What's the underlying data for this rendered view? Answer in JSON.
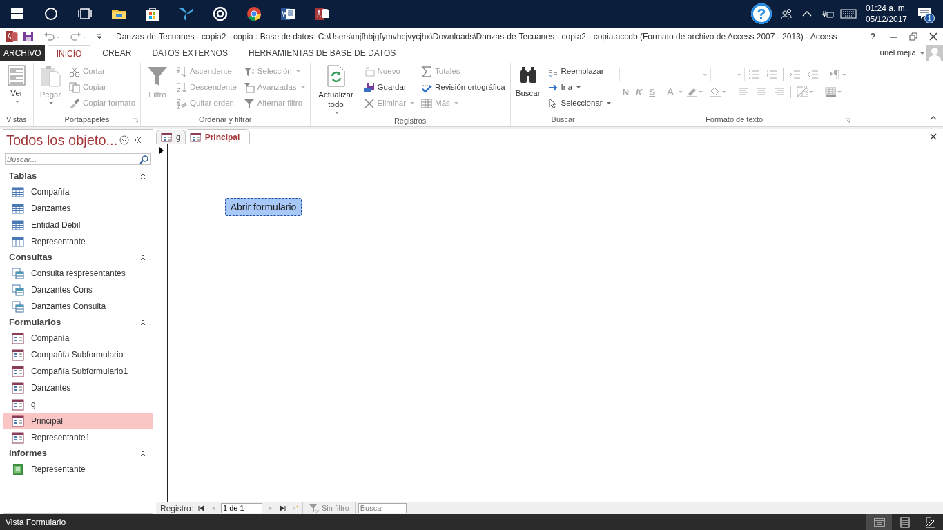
{
  "taskbar": {
    "help_label": "?",
    "time": "01:24 a. m.",
    "date": "05/12/2017",
    "notification_count": "1"
  },
  "window": {
    "title": "Danzas-de-Tecuanes - copia2 - copia : Base de datos- C:\\Users\\mjfhbjgfymvhcjvycjhx\\Downloads\\Danzas-de-Tecuanes - copia2 - copia.accdb (Formato de archivo de Access 2007 - 2013) - Access",
    "help_label": "?",
    "user": "uriel mejia"
  },
  "ribbon_tabs": [
    {
      "label": "ARCHIVO",
      "kind": "file",
      "selected": false
    },
    {
      "label": "INICIO",
      "kind": "tab",
      "selected": true
    },
    {
      "label": "CREAR",
      "kind": "tab",
      "selected": false
    },
    {
      "label": "DATOS EXTERNOS",
      "kind": "tab",
      "selected": false
    },
    {
      "label": "HERRAMIENTAS DE BASE DE DATOS",
      "kind": "tab",
      "selected": false
    }
  ],
  "ribbon_groups": [
    {
      "label": "Vistas",
      "launcher": false,
      "columns": [
        [
          {
            "label": "Ver",
            "kind": "large",
            "disabled": false,
            "menu": true
          }
        ]
      ]
    },
    {
      "label": "Portapapeles",
      "launcher": true,
      "columns": [
        [
          {
            "label": "Pegar",
            "kind": "large",
            "disabled": true,
            "menu": true
          }
        ],
        [
          {
            "label": "Cortar",
            "kind": "small",
            "disabled": true,
            "menu": false
          },
          {
            "label": "Copiar",
            "kind": "small",
            "disabled": true,
            "menu": false
          },
          {
            "label": "Copiar formato",
            "kind": "small",
            "disabled": true,
            "menu": false
          }
        ]
      ]
    },
    {
      "label": "Ordenar y filtrar",
      "launcher": false,
      "columns": [
        [
          {
            "label": "Filtro",
            "kind": "large",
            "disabled": true,
            "menu": false
          }
        ],
        [
          {
            "label": "Ascendente",
            "kind": "small",
            "disabled": true,
            "menu": false
          },
          {
            "label": "Descendente",
            "kind": "small",
            "disabled": true,
            "menu": false
          },
          {
            "label": "Quitar orden",
            "kind": "small",
            "disabled": true,
            "menu": false
          }
        ],
        [
          {
            "label": "Selección",
            "kind": "small",
            "disabled": true,
            "menu": true
          },
          {
            "label": "Avanzadas",
            "kind": "small",
            "disabled": true,
            "menu": true
          },
          {
            "label": "Alternar filtro",
            "kind": "small",
            "disabled": true,
            "menu": false
          }
        ]
      ]
    },
    {
      "label": "Registros",
      "launcher": false,
      "columns": [
        [
          {
            "label": "Actualizar todo",
            "kind": "large",
            "disabled": false,
            "menu": true
          }
        ],
        [
          {
            "label": "Nuevo",
            "kind": "small",
            "disabled": true,
            "menu": false
          },
          {
            "label": "Guardar",
            "kind": "small",
            "disabled": false,
            "menu": false
          },
          {
            "label": "Eliminar",
            "kind": "small",
            "disabled": true,
            "menu": true
          }
        ],
        [
          {
            "label": "Totales",
            "kind": "small",
            "disabled": true,
            "menu": false
          },
          {
            "label": "Revisión ortográfica",
            "kind": "small",
            "disabled": false,
            "menu": false
          },
          {
            "label": "Más",
            "kind": "small",
            "disabled": true,
            "menu": true
          }
        ]
      ]
    },
    {
      "label": "Buscar",
      "launcher": false,
      "columns": [
        [
          {
            "label": "Buscar",
            "kind": "large",
            "disabled": false,
            "menu": false
          }
        ],
        [
          {
            "label": "Reemplazar",
            "kind": "small",
            "disabled": false,
            "menu": false
          },
          {
            "label": "Ir a",
            "kind": "small",
            "disabled": false,
            "menu": true
          },
          {
            "label": "Seleccionar",
            "kind": "small",
            "disabled": false,
            "menu": true
          }
        ]
      ]
    }
  ],
  "text_format": {
    "label": "Formato de texto",
    "launcher": true,
    "disabled": true,
    "bold": "N",
    "italic": "K",
    "underline": "S",
    "font_color": "A"
  },
  "nav_pane": {
    "title": "Todos los objeto...",
    "search_placeholder": "Buscar...",
    "groups": [
      {
        "label": "Tablas",
        "kind": "table",
        "expanded": true,
        "items": [
          {
            "label": "Compañía",
            "selected": false
          },
          {
            "label": "Danzantes",
            "selected": false
          },
          {
            "label": "Entidad Debil",
            "selected": false
          },
          {
            "label": "Representante",
            "selected": false
          }
        ]
      },
      {
        "label": "Consultas",
        "kind": "query",
        "expanded": true,
        "items": [
          {
            "label": "Consulta respresentantes",
            "selected": false
          },
          {
            "label": "Danzantes Cons",
            "selected": false
          },
          {
            "label": "Danzantes Consulta",
            "selected": false
          }
        ]
      },
      {
        "label": "Formularios",
        "kind": "form",
        "expanded": true,
        "items": [
          {
            "label": "Compañía",
            "selected": false
          },
          {
            "label": "Compañía Subformulario",
            "selected": false
          },
          {
            "label": "Compañía Subformulario1",
            "selected": false
          },
          {
            "label": "Danzantes",
            "selected": false
          },
          {
            "label": "g",
            "selected": false
          },
          {
            "label": "Principal",
            "selected": true
          },
          {
            "label": "Representante1",
            "selected": false
          }
        ]
      },
      {
        "label": "Informes",
        "kind": "report",
        "expanded": true,
        "items": [
          {
            "label": "Representante",
            "selected": false
          }
        ]
      }
    ]
  },
  "document_tabs": [
    {
      "label": "g",
      "selected": false
    },
    {
      "label": "Principal",
      "selected": true
    }
  ],
  "form": {
    "button": "Abrir formulario",
    "focused": true
  },
  "record_nav": {
    "label": "Registro:",
    "position": "1 de 1",
    "filter": "Sin filtro",
    "search_placeholder": "Buscar"
  },
  "status_bar": {
    "text": "Vista Formulario",
    "views": [
      {
        "selected": true
      },
      {
        "selected": false
      },
      {
        "selected": false
      }
    ]
  }
}
